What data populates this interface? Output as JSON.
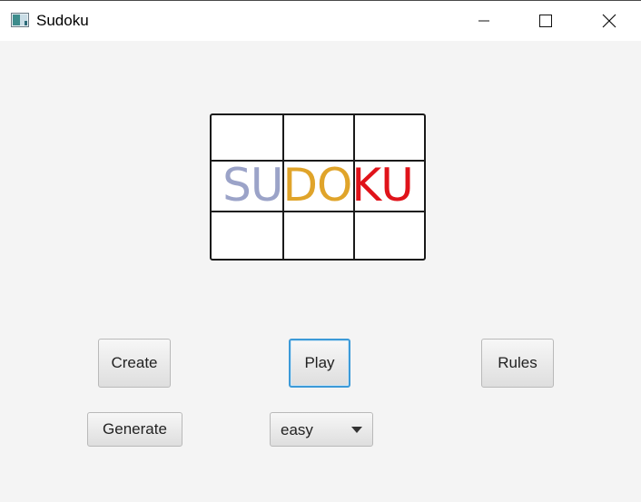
{
  "window": {
    "title": "Sudoku",
    "app_icon": "java-app-icon",
    "controls": {
      "minimize_icon": "minimize-icon",
      "maximize_icon": "maximize-icon",
      "close_icon": "close-icon"
    }
  },
  "logo": {
    "letters": [
      {
        "text": "S",
        "color": "#9ba3c8"
      },
      {
        "text": "U",
        "color": "#9ba3c8"
      },
      {
        "text": "D",
        "color": "#e0a42a"
      },
      {
        "text": "O",
        "color": "#e0a42a"
      },
      {
        "text": "K",
        "color": "#e0131a"
      },
      {
        "text": "U",
        "color": "#e0131a"
      }
    ],
    "grid_color": "#1a1a1a"
  },
  "buttons": {
    "create": "Create",
    "play": "Play",
    "rules": "Rules",
    "generate": "Generate"
  },
  "difficulty": {
    "selected": "easy"
  },
  "colors": {
    "background": "#f4f4f4",
    "focus_border": "#3c9ad8"
  }
}
